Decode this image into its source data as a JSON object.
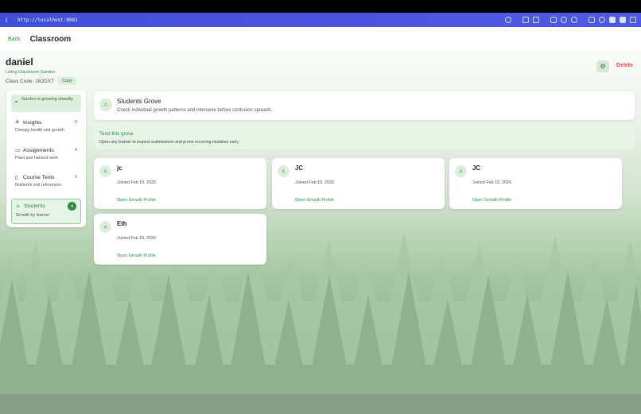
{
  "browser": {
    "info_icon": "i",
    "url": "http://localhost:8081"
  },
  "header": {
    "back_label": "Back",
    "title": "Classroom"
  },
  "classroom": {
    "name": "daniel",
    "garden_name": "Living Classroom Garden",
    "class_code": "Class Code: 262DXT",
    "copy_label": "Copy",
    "delete_label": "Delete"
  },
  "sidebar": {
    "status": "Garden is growing steadily",
    "items": [
      {
        "label": "Insights",
        "count": "0",
        "subtitle": "Canopy health and growth",
        "icon": "chart-icon"
      },
      {
        "label": "Assignments",
        "count": "4",
        "subtitle": "Plant and harvest work",
        "icon": "book-icon"
      },
      {
        "label": "Course Texts",
        "count": "1",
        "subtitle": "Nutrients and references",
        "icon": "document-icon"
      },
      {
        "label": "Students",
        "count": "4",
        "subtitle": "Growth by learner",
        "icon": "students-icon"
      }
    ]
  },
  "main": {
    "grove_title": "Students Grove",
    "grove_desc": "Check individual growth patterns and intervene before confusion spreads.",
    "tend_title": "Tend this grove",
    "tend_desc": "Open any learner to inspect submissions and prune recurring mistakes early.",
    "students": [
      {
        "name": "jc",
        "joined": "Joined Feb 15, 2026",
        "link": "Open Growth Profile"
      },
      {
        "name": "JC",
        "joined": "Joined Feb 15, 2026",
        "link": "Open Growth Profile"
      },
      {
        "name": "JC",
        "joined": "Joined Feb 15, 2026",
        "link": "Open Growth Profile"
      },
      {
        "name": "Eth",
        "joined": "Joined Feb 15, 2026",
        "link": "Open Growth Profile"
      }
    ]
  },
  "colors": {
    "accent": "#2f8a43",
    "danger": "#e24a4a",
    "toolbar": "#4a52e0"
  }
}
